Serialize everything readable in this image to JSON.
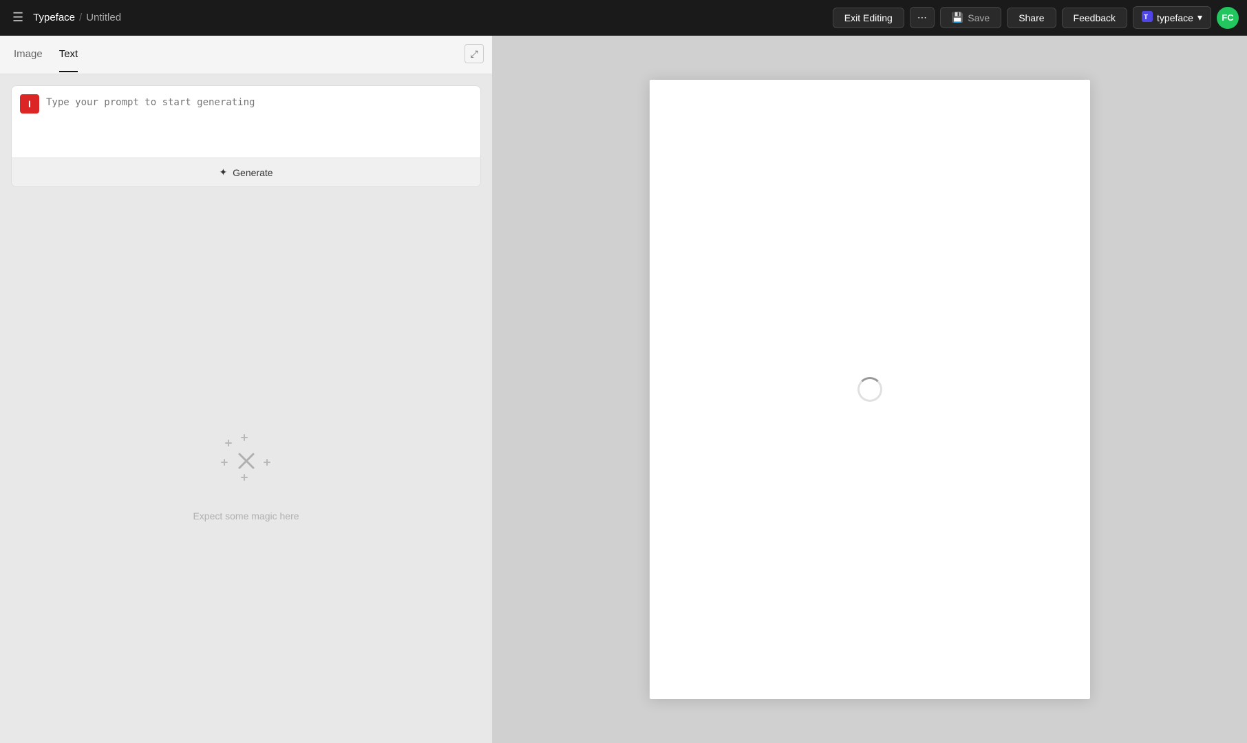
{
  "topbar": {
    "menu_icon": "☰",
    "brand": "Typeface",
    "separator": "/",
    "page": "Untitled",
    "exit_editing_label": "Exit Editing",
    "more_label": "•••",
    "save_label": "Save",
    "share_label": "Share",
    "feedback_label": "Feedback",
    "typeface_label": "typeface",
    "avatar_label": "FC"
  },
  "left_panel": {
    "tabs": [
      {
        "id": "image",
        "label": "Image",
        "active": false
      },
      {
        "id": "text",
        "label": "Text",
        "active": true
      }
    ],
    "prompt_icon_label": "I",
    "prompt_placeholder": "Type your prompt to start generating",
    "generate_label": "Generate",
    "generate_icon": "✦",
    "magic_text": "Expect some magic here"
  },
  "right_panel": {
    "canvas_loading": true
  }
}
